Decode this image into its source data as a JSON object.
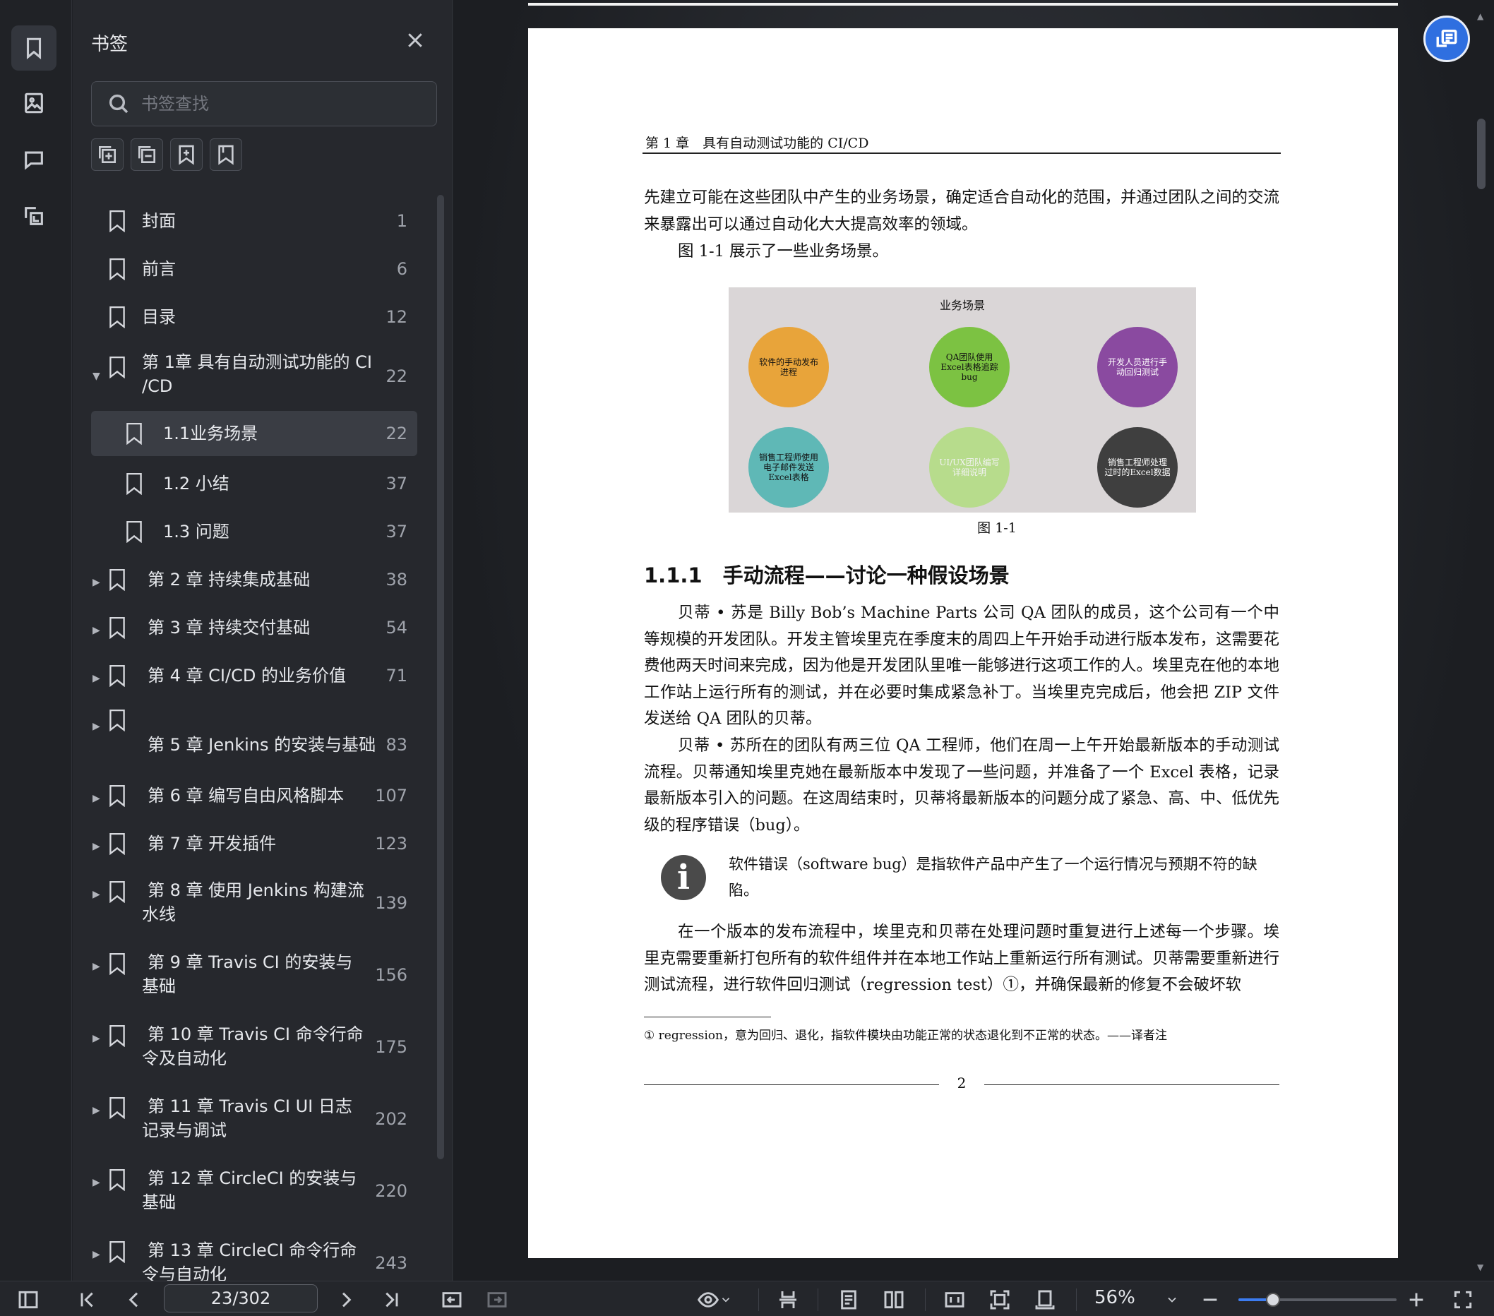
{
  "sidebar": {
    "title": "书签",
    "search_placeholder": "书签查找",
    "items": [
      {
        "label": "封面",
        "page": "1"
      },
      {
        "label": "前言",
        "page": "6"
      },
      {
        "label": "目录",
        "page": "12"
      },
      {
        "label": "第 1章 具有自动测试功能的 CI /CD",
        "page": "22",
        "expanded": true
      },
      {
        "label": "1.1业务场景",
        "page": "22",
        "selected": true
      },
      {
        "label": "1.2 小结",
        "page": "37"
      },
      {
        "label": "1.3 问题",
        "page": "37"
      },
      {
        "label": "第 2 章 持续集成基础",
        "page": "38"
      },
      {
        "label": "第 3 章 持续交付基础",
        "page": "54"
      },
      {
        "label": "第 4 章 CI/CD 的业务价值",
        "page": "71"
      },
      {
        "label": "第 5 章 Jenkins 的安装与基础",
        "page": "83"
      },
      {
        "label": "第 6 章 编写自由风格脚本",
        "page": "107"
      },
      {
        "label": "第 7 章 开发插件",
        "page": "123"
      },
      {
        "label": "第 8 章 使用 Jenkins 构建流水线",
        "page": "139"
      },
      {
        "label": "第 9 章 Travis CI 的安装与基础",
        "page": "156"
      },
      {
        "label": "第 10 章 Travis CI 命令行命令及自动化",
        "page": "175"
      },
      {
        "label": "第 11 章 Travis CI UI 日志记录与调试",
        "page": "202"
      },
      {
        "label": "第 12 章 CircleCI 的安装与基础",
        "page": "220"
      },
      {
        "label": "第 13 章 CircleCI 命令行命令与自动化",
        "page": "243"
      }
    ]
  },
  "document": {
    "running_head": "第 1 章　具有自动测试功能的 CI/CD",
    "para1": "先建立可能在这些团队中产生的业务场景，确定适合自动化的范围，并通过团队之间的交流来暴露出可以通过自动化大大提高效率的领域。",
    "para2": "图 1-1 展示了一些业务场景。",
    "figure": {
      "title": "业务场景",
      "caption": "图 1-1",
      "nodes": [
        {
          "text": "软件的手动发布进程",
          "color": "#e8a43a"
        },
        {
          "text": "QA团队使用Excel表格追踪bug",
          "color": "#7cc242"
        },
        {
          "text": "开发人员进行手动回归测试",
          "color": "#8a4aa0"
        },
        {
          "text": "销售工程师使用电子邮件发送Excel表格",
          "color": "#5fb8b6"
        },
        {
          "text": "UI/UX团队编写详细说明",
          "color": "#b7dc8c"
        },
        {
          "text": "销售工程师处理过时的Excel数据",
          "color": "#3f3f3f"
        }
      ]
    },
    "section_heading": "1.1.1　手动流程——讨论一种假设场景",
    "para3": "贝蒂 • 苏是 Billy Bob’s Machine Parts 公司 QA 团队的成员，这个公司有一个中等规模的开发团队。开发主管埃里克在季度末的周四上午开始手动进行版本发布，这需要花费他两天时间来完成，因为他是开发团队里唯一能够进行这项工作的人。埃里克在他的本地工作站上运行所有的测试，并在必要时集成紧急补丁。当埃里克完成后，他会把 ZIP 文件发送给 QA 团队的贝蒂。",
    "para4": "贝蒂 • 苏所在的团队有两三位 QA 工程师，他们在周一上午开始最新版本的手动测试流程。贝蒂通知埃里克她在最新版本中发现了一些问题，并准备了一个 Excel 表格，记录最新版本引入的问题。在这周结束时，贝蒂将最新版本的问题分成了紧急、高、中、低优先级的程序错误（bug）。",
    "note": "软件错误（software bug）是指软件产品中产生了一个运行情况与预期不符的缺陷。",
    "para5": "在一个版本的发布流程中，埃里克和贝蒂在处理问题时重复进行上述每一个步骤。埃里克需要重新打包所有的软件组件并在本地工作站上重新运行所有测试。贝蒂需要重新进行测试流程，进行软件回归测试（regression test）①，并确保最新的修复不会破坏软",
    "footnote": "① regression，意为回归、退化，指软件模块由功能正常的状态退化到不正常的状态。——译者注",
    "page_number": "2"
  },
  "toolbar": {
    "page_indicator": "23/302",
    "zoom": "56%",
    "zoom_fraction": 0.22
  }
}
